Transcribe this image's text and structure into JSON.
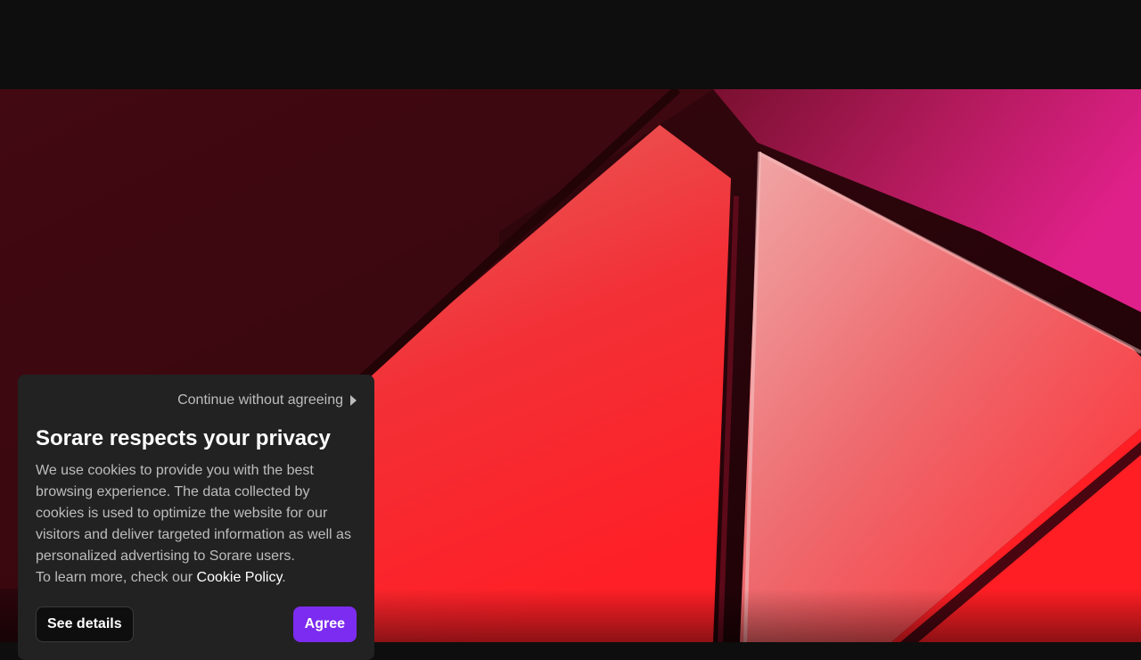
{
  "cookie_banner": {
    "continue_label": "Continue without agreeing",
    "continue_icon": "caret-right-icon",
    "title": "Sorare respects your privacy",
    "body": "We use cookies to provide you with the best browsing experience. The data collected by cookies is used to optimize the website for our visitors and deliver targeted information as well as personalized advertising to Sorare users.",
    "learn_more_prefix": "To learn more, check our ",
    "cookie_policy_link": "Cookie Policy",
    "learn_more_suffix": ".",
    "see_details_label": "See details",
    "agree_label": "Agree"
  },
  "colors": {
    "background": "#0e0e0e",
    "panel": "#222222",
    "accent": "#7c2cf0",
    "hero_red": "#e8202a"
  }
}
